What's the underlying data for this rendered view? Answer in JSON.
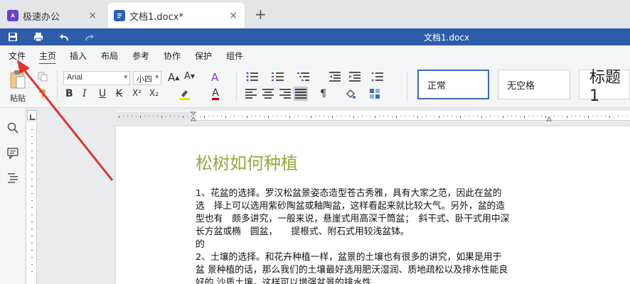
{
  "tabs": [
    {
      "label": "极速办公"
    },
    {
      "label": "文档1.docx*"
    }
  ],
  "new_tab_symbol": "+",
  "close_symbol": "×",
  "window_title": "文档1.docx",
  "menu": [
    "文件",
    "主页",
    "插入",
    "布局",
    "参考",
    "协作",
    "保护",
    "组件"
  ],
  "active_menu": "主页",
  "ribbon": {
    "paste_label": "粘贴",
    "font_name": "Arial",
    "font_size": "小四",
    "bold": "B",
    "italic": "I",
    "underline": "U",
    "strike": "K",
    "superscript": "X²",
    "subscript": "X₂",
    "grow_font": "A",
    "shrink_font": "A",
    "font_color": "A",
    "styles": [
      "正常",
      "无空格",
      "标题1"
    ]
  },
  "document": {
    "title": "松树如何种植",
    "paragraphs": [
      "1、花盆的选择。罗汉松盆景姿态造型苍古秀雅，具有大家之范，因此在盆的",
      "选　择上可以选用紫砂陶盆或釉陶盆，这样看起来就比较大气。另外，盆的造",
      "型也有　颇多讲究，一般来说，悬崖式用高深千筒盆；　斜干式、卧干式用中深",
      "长方盆或椭　圆盆，　　提根式、附石式用较浅盆钵。",
      "的",
      "2、土壤的选择。和花卉种植一样，盆景的土壤也有很多的讲究，如果是用于",
      "盆 景种植的话，那么我们的土壤最好选用肥沃湿润、质地疏松以及排水性能良",
      "好的 沙质土壤，这样可以增强盆景的排水性"
    ]
  },
  "colors": {
    "title_bar": "#2d5ca8",
    "heading": "#9aa63f",
    "arrow": "#e0322b"
  }
}
